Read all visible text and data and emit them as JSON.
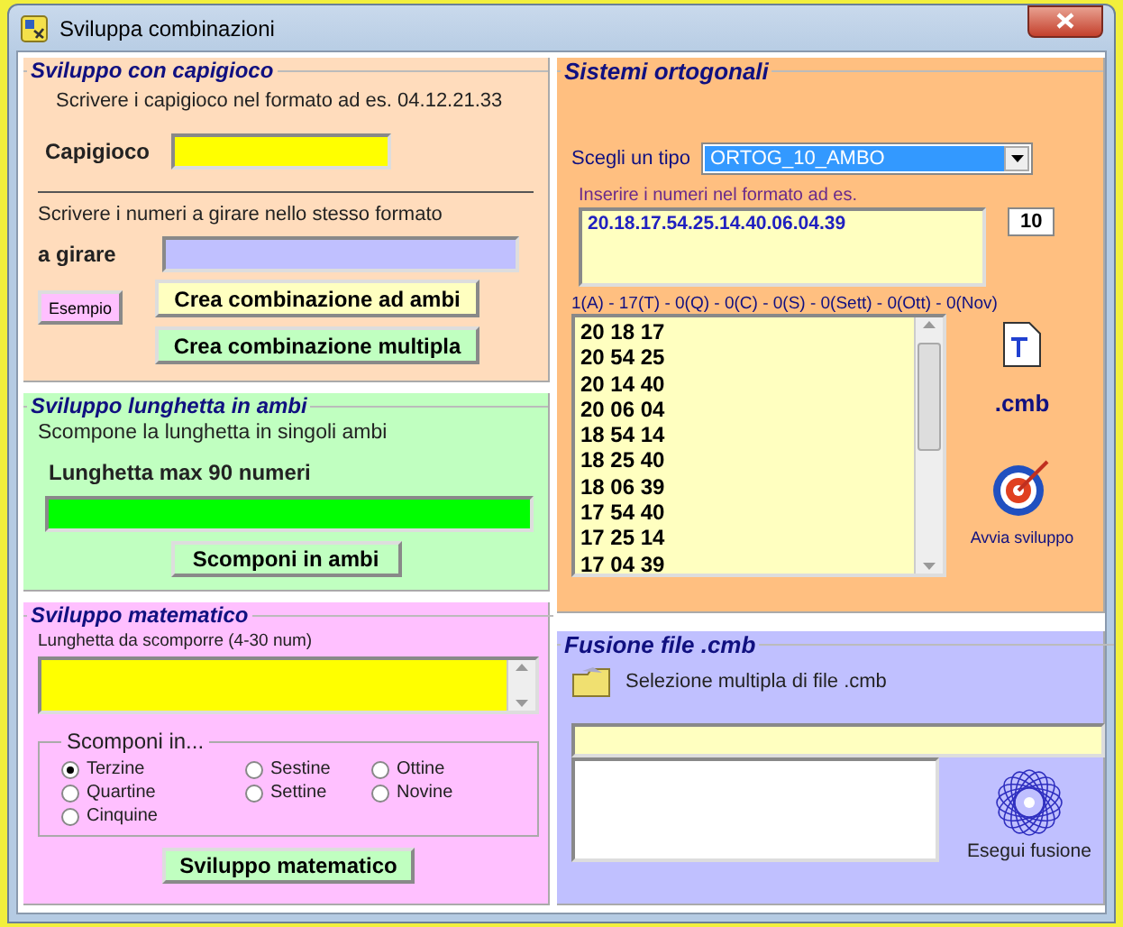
{
  "window": {
    "title": "Sviluppa combinazioni"
  },
  "capigioco": {
    "title": "Sviluppo con capigioco",
    "hint": "Scrivere i capigioco nel formato ad es. 04.12.21.33",
    "field_label": "Capigioco",
    "hint2": "Scrivere i numeri a girare nello stesso formato",
    "field2_label": "a girare",
    "example_button": "Esempio",
    "buttons": [
      "Crea combinazione ad ambi",
      "Crea combinazione multipla"
    ]
  },
  "lunghetta": {
    "title": "Sviluppo lunghetta in ambi",
    "hint": "Scompone la lunghetta in singoli ambi",
    "field_label": "Lunghetta max 90 numeri",
    "button": "Scomponi in ambi"
  },
  "matematico": {
    "title": "Sviluppo matematico",
    "field_label": "Lunghetta da scomporre (4-30 num)",
    "group_title": "Scomponi in...",
    "options": [
      {
        "label": "Terzine",
        "selected": true
      },
      {
        "label": "Quartine",
        "selected": false
      },
      {
        "label": "Cinquine",
        "selected": false
      },
      {
        "label": "Sestine",
        "selected": false
      },
      {
        "label": "Settine",
        "selected": false
      },
      {
        "label": "Ottine",
        "selected": false
      },
      {
        "label": "Novine",
        "selected": false
      }
    ],
    "button": "Sviluppo matematico"
  },
  "ortogonali": {
    "title": "Sistemi ortogonali",
    "type_label": "Scegli un tipo",
    "type_value": "ORTOG_10_AMBO",
    "numbers_label": "Inserire i numeri nel formato ad es.",
    "numbers_value": "20.18.17.54.25.14.40.06.04.39",
    "count": "10",
    "summary": "1(A) - 17(T) - 0(Q) - 0(C) - 0(S) - 0(Sett) - 0(Ott) - 0(Nov)",
    "rows": [
      "20 18 17",
      "20 54 25",
      "20 14 40",
      "20 06 04",
      "18 54 14",
      "18 25 40",
      "18 06 39",
      "17 54 40",
      "17 25 14",
      "17 04 39"
    ],
    "ext_label": ".cmb",
    "start_label": "Avvia sviluppo"
  },
  "fusione": {
    "title": "Fusione file .cmb",
    "select_label": "Selezione multipla di file .cmb",
    "run_label": "Esegui fusione"
  }
}
